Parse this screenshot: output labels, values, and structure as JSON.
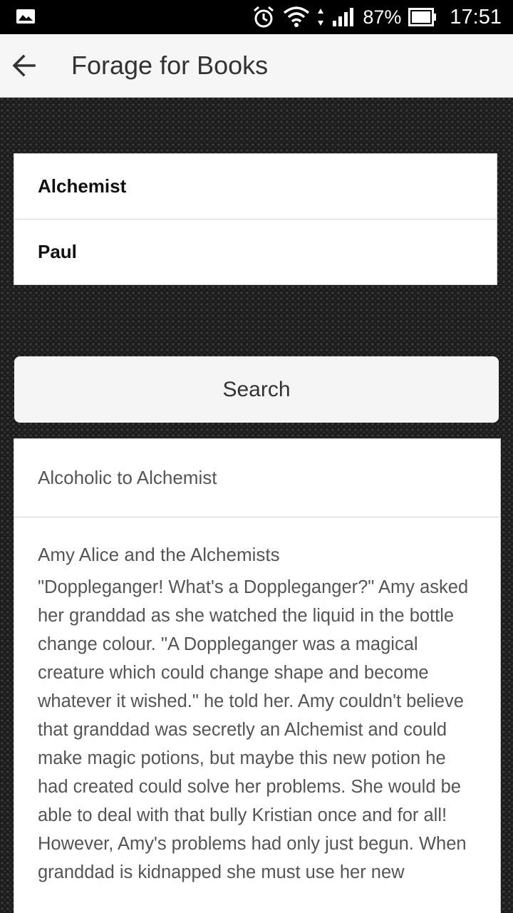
{
  "status_bar": {
    "battery_percent": "87%",
    "time": "17:51",
    "icons": [
      "image-icon",
      "alarm-icon",
      "wifi-icon",
      "signal-icon",
      "battery-icon"
    ]
  },
  "app_bar": {
    "title": "Forage for Books",
    "back_icon": "arrow-left-icon"
  },
  "form": {
    "title_value": "Alchemist",
    "author_value": "Paul"
  },
  "search_button": {
    "label": "Search"
  },
  "results": [
    {
      "title": "Alcoholic to Alchemist"
    },
    {
      "title": "Amy Alice and the Alchemists",
      "description": "\"Doppleganger! What's a Doppleganger?\" Amy asked her granddad as she watched the liquid in the bottle change colour. \"A Doppleganger was a magical creature which could change shape and become whatever it wished.\" he told her. Amy couldn't believe that granddad was secretly an Alchemist and could make magic potions, but maybe this new potion he had created could solve her problems. She would be able to deal with that bully Kristian once and for all! However, Amy's problems had only just begun. When granddad is kidnapped she must use her new"
    }
  ]
}
